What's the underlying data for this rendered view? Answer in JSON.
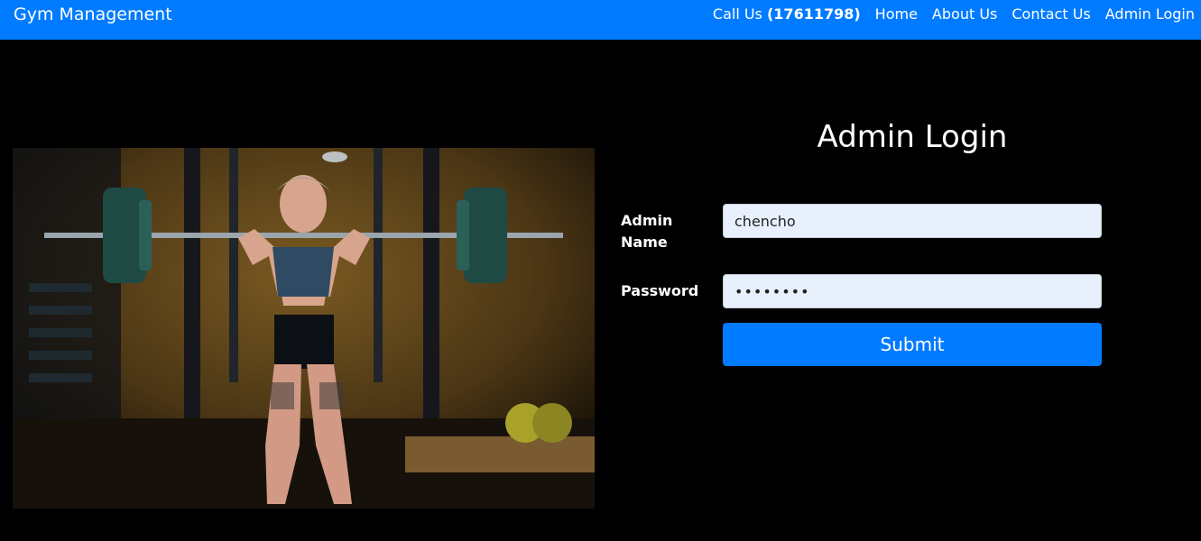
{
  "navbar": {
    "brand": "Gym Management",
    "call_prefix": "Call Us",
    "call_number": "(17611798)",
    "links": [
      "Home",
      "About Us",
      "Contact Us",
      "Admin Login"
    ]
  },
  "login": {
    "title": "Admin Login",
    "name_label": "Admin Name",
    "name_value": "chencho",
    "password_label": "Password",
    "password_value": "chencho1",
    "submit_label": "Submit"
  },
  "colors": {
    "primary": "#007bff",
    "background": "#000000",
    "input_bg": "#e8f0fe"
  }
}
